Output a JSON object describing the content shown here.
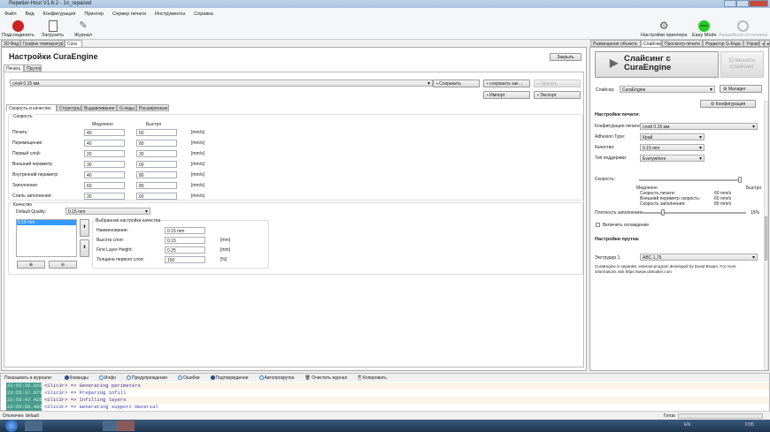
{
  "window": {
    "title": "Repetier-Host V1.6.2 - 1n_repaired"
  },
  "menu": [
    "Файл",
    "Вид",
    "Конфигурация",
    "Принтер",
    "Сервер печати",
    "Инструменты",
    "Справка"
  ],
  "toolbar": {
    "connect": "Подсоединить",
    "load": "Загрузить",
    "log": "Журнал",
    "printer_settings": "Настройки принтера",
    "easy_mode": "Easy Mode",
    "easy_badge": "EASY",
    "emergency": "Аварийная остановка"
  },
  "left_tabs": [
    "3D-Вид",
    "График температур",
    "Cura"
  ],
  "cura": {
    "title": "Настройки CuraEngine",
    "close": "Закрыть",
    "tabs": [
      "Печать",
      "Пруток"
    ],
    "profile": "слой 0.15 мм",
    "buttons": {
      "save": "Сохранить",
      "save_as": "сохранить как ...",
      "delete": "Удалить",
      "import": "Импорт",
      "export": "Экспорт"
    },
    "inner_tabs": [
      "Скорость и качество",
      "Структуры",
      "Выдавливание",
      "G-коды",
      "Расширенные"
    ],
    "speed": {
      "title": "Скорость",
      "slow": "Медленно",
      "fast": "Быстро",
      "rows": [
        {
          "label": "Печать:",
          "slow": "40",
          "fast": "60",
          "unit": "[mm/s]"
        },
        {
          "label": "Перемещение:",
          "slow": "40",
          "fast": "80",
          "unit": "[mm/s]"
        },
        {
          "label": "Первый слой:",
          "slow": "20",
          "fast": "30",
          "unit": "[mm/s]"
        },
        {
          "label": "Внешний периметр",
          "slow": "30",
          "fast": "60",
          "unit": "[mm/s]"
        },
        {
          "label": "Внутренний периметр",
          "slow": "40",
          "fast": "80",
          "unit": "[mm/s]"
        },
        {
          "label": "Заполнение:",
          "slow": "60",
          "fast": "80",
          "unit": "[mm/s]"
        },
        {
          "label": "Слиль заполнения:",
          "slow": "30",
          "fast": "60",
          "unit": "[mm/s]"
        }
      ]
    },
    "quality": {
      "title": "Качество",
      "default_label": "Default Quality:",
      "default_value": "0.15 mm",
      "list": [
        "0.15 mm"
      ],
      "selected_title": "Выбранная настройка качества",
      "rows": [
        {
          "label": "Наименование:",
          "value": "0.15 mm",
          "unit": ""
        },
        {
          "label": "Высота слоя:",
          "value": "0.15",
          "unit": "[mm]"
        },
        {
          "label": "First Layer Height:",
          "value": "0.25",
          "unit": "[mm]"
        },
        {
          "label": "Толщина первого слоя:",
          "value": "150",
          "unit": "[%]"
        }
      ]
    }
  },
  "right_tabs": [
    "Размещение объекта",
    "Слайсер",
    "Просмотр печати",
    "Редактор G-Кода",
    "Управ"
  ],
  "slicer": {
    "slice_button": "Слайсинг с CuraEngine",
    "cancel": "Отменить слайсинг",
    "slicer_label": "Слайсер:",
    "slicer_value": "CuraEngine",
    "manager": "Manager",
    "configuration": "Конфигурация",
    "print_settings": "Настройки печати:",
    "rows": [
      {
        "label": "Конфигурация печати:",
        "value": "слой 0.15 мм"
      },
      {
        "label": "Adhesion Type:",
        "value": "Край"
      },
      {
        "label": "Качество:",
        "value": "0.15 mm"
      },
      {
        "label": "Тип поддержки:",
        "value": "Everywhere"
      }
    ],
    "speed_label": "Скорость:",
    "speed_slider": 1.0,
    "slow": "Медленно",
    "fast": "Быстро",
    "stats": [
      {
        "label": "Скорость печати:",
        "value": "60 mm/s"
      },
      {
        "label": "Внешний периметр скорость:",
        "value": "60 mm/s"
      },
      {
        "label": "Скорость заполнения:",
        "value": "80 mm/s"
      }
    ],
    "infill_label": "Плотность заполнения:",
    "infill_value": "15%",
    "infill_fraction": 0.15,
    "cooling": "Включить охлаждение",
    "cooling_checked": false,
    "filament_settings": "Настройки прутка:",
    "extruder_label": "Экструдер 1:",
    "extruder_value": "ABC 1,75",
    "note": "CuraEngine is separate, external program developed by David Braam. For more informations visit https://www.ultimaker.com"
  },
  "log": {
    "show_label": "Показывать в журнале:",
    "filters": [
      {
        "label": "Команды",
        "on": true
      },
      {
        "label": "Инфо",
        "on": false
      },
      {
        "label": "Предупреждения",
        "on": false
      },
      {
        "label": "Ошибки",
        "on": false
      },
      {
        "label": "Подтверждение",
        "on": true
      },
      {
        "label": "Автопрокрутка",
        "on": false
      }
    ],
    "clear": "Очистить журнал",
    "copy": "Копировать",
    "entries": [
      {
        "time": "23:55:35.010",
        "msg": "<Slic3r> => Generating perimeters"
      },
      {
        "time": "23:55:37.073",
        "msg": "<Slic3r> => Preparing infill"
      },
      {
        "time": "23:55:47.425",
        "msg": "<Slic3r> => Infilling layers"
      },
      {
        "time": "23:55:50.405",
        "msg": "<Slic3r> => Generating support material"
      }
    ]
  },
  "status": {
    "left": "Отключен: default",
    "ready": "Готов"
  },
  "taskbar": {
    "lang": "EN",
    "clock": "0:05"
  },
  "colors": {
    "log_time_bg": "#4a9a8e",
    "easy_green": "#22cc22",
    "connect_red": "#cc2222"
  }
}
